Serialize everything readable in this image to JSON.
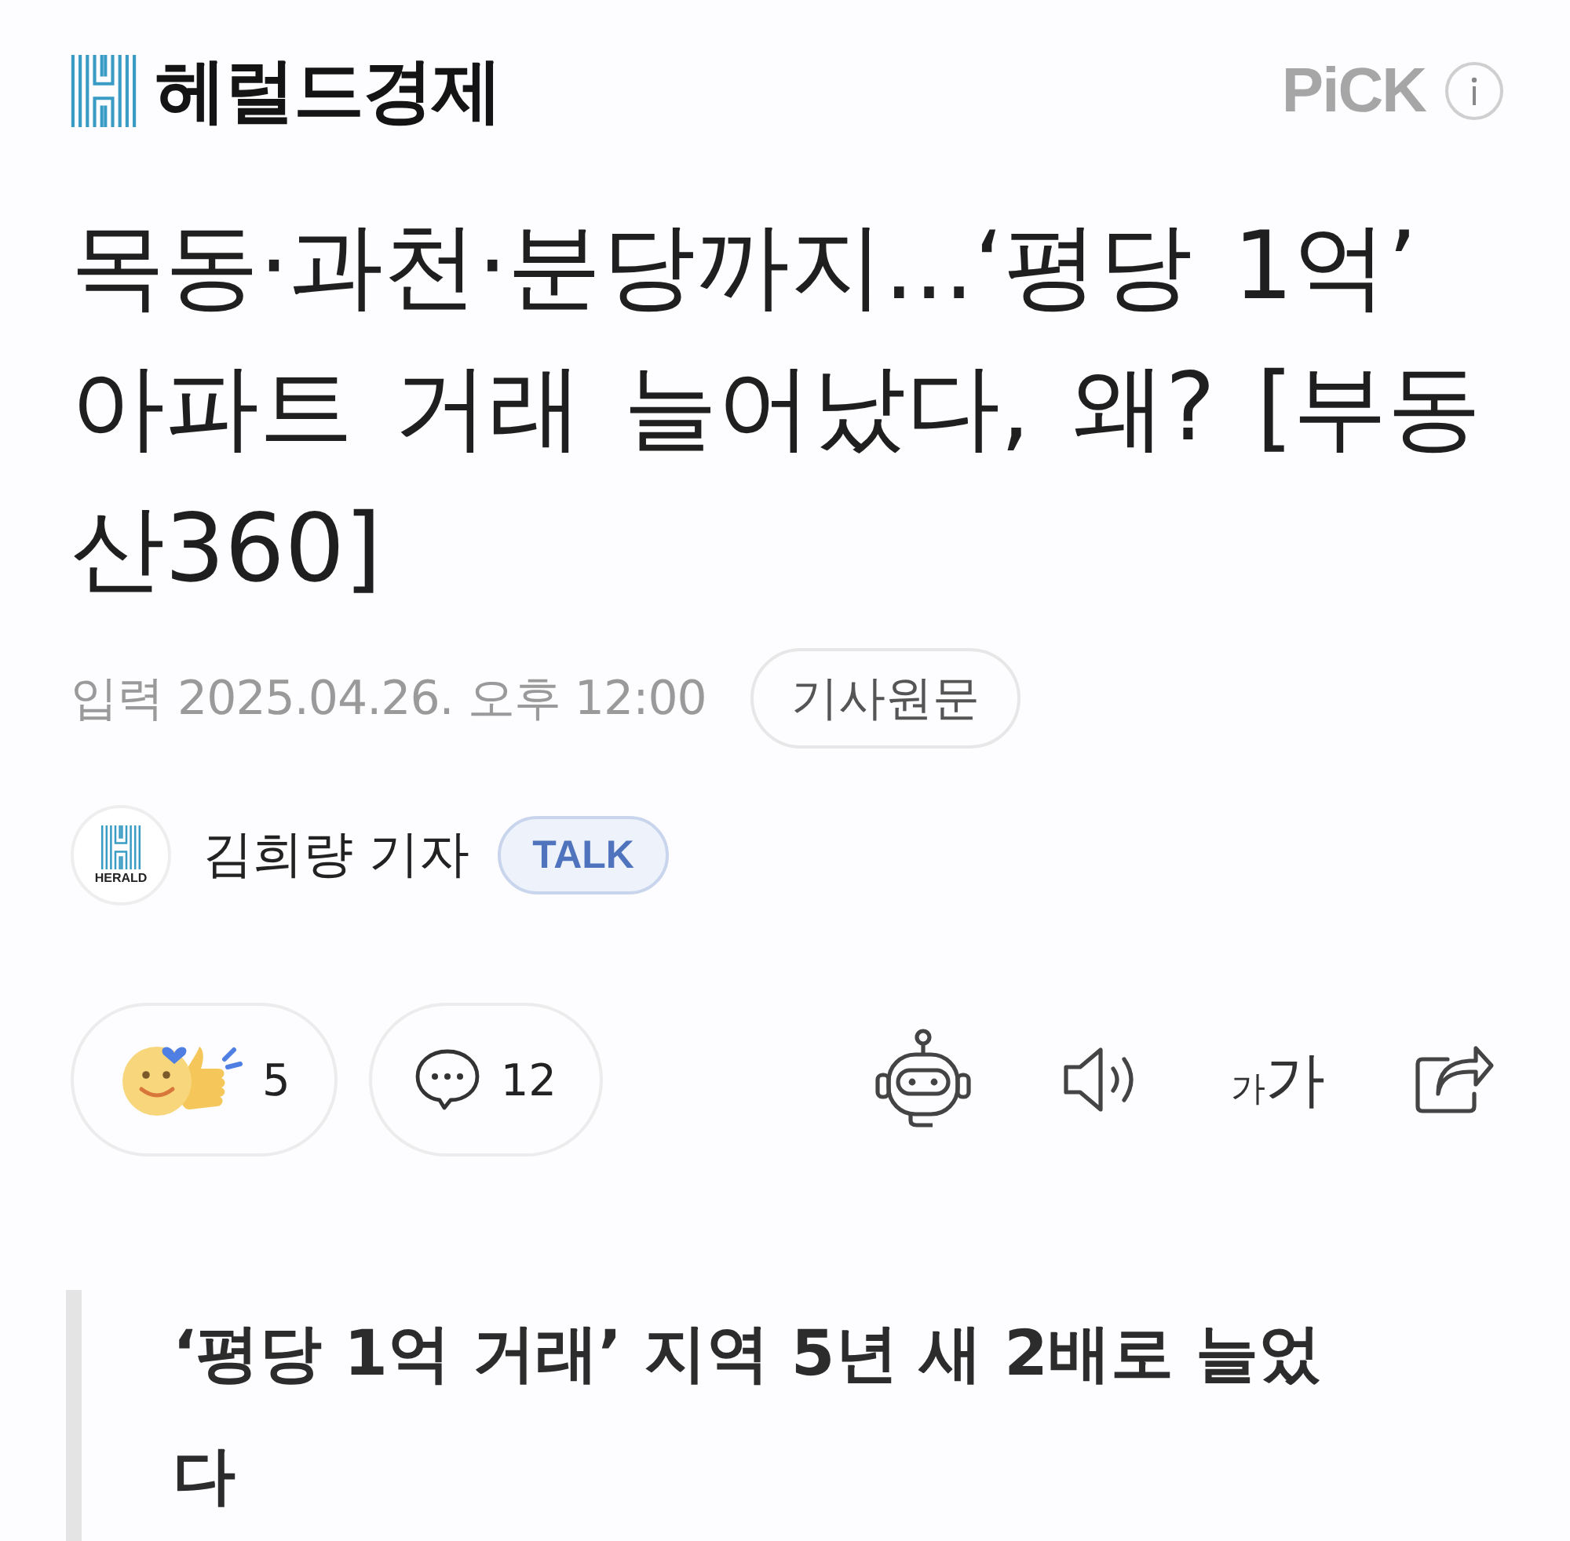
{
  "header": {
    "brand": "헤럴드경제",
    "pick_label": "PiCK"
  },
  "headline": "목동·과천·분당까지...‘평당 1억’ 아파트 거래 늘어났다, 왜? [부동산360]",
  "meta": {
    "published": "입력 2025.04.26. 오후 12:00",
    "original_button": "기사원문"
  },
  "author": {
    "avatar_label": "HERALD",
    "name": "김희량 기자",
    "talk_button": "TALK"
  },
  "actions": {
    "reactions": "5",
    "comments": "12",
    "text_size_small": "가",
    "text_size_large": "가"
  },
  "subheading": "‘평당 1억 거래’ 지역 5년 새 2배로 늘었다"
}
